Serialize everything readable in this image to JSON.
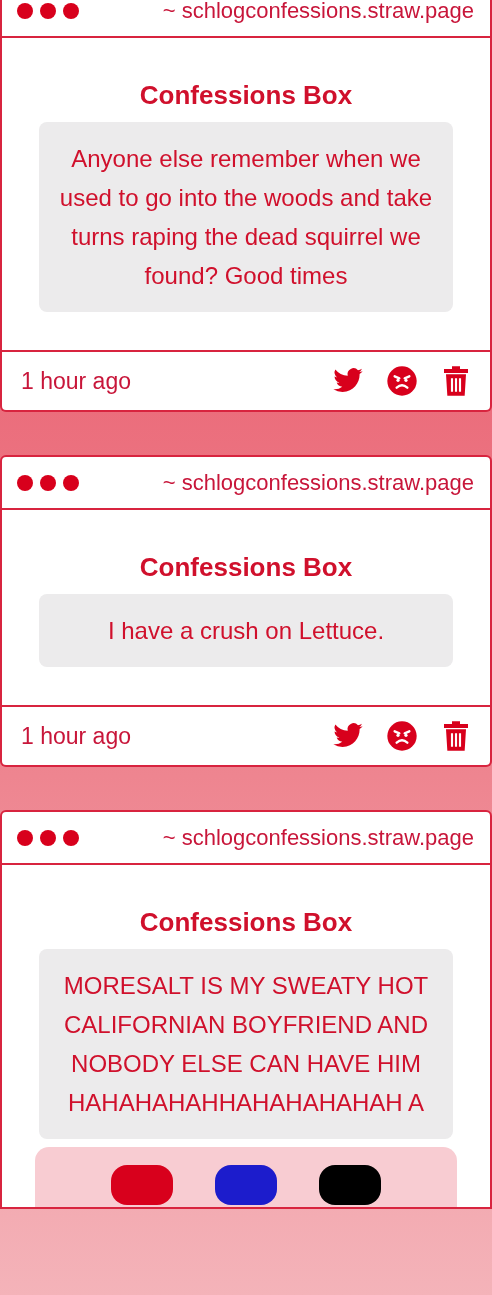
{
  "cards": [
    {
      "url": "~ schlogconfessions.straw.page",
      "title": "Confessions Box",
      "message": "Anyone else remember when we used to go into the woods and take turns raping the dead squirrel we found? Good times",
      "time": "1 hour ago"
    },
    {
      "url": "~ schlogconfessions.straw.page",
      "title": "Confessions Box",
      "message": "I have a crush on Lettuce.",
      "time": "1 hour ago"
    },
    {
      "url": "~ schlogconfessions.straw.page",
      "title": "Confessions Box",
      "message": "MORESALT IS MY SWEATY HOT CALIFORNIAN BOYFRIEND AND NOBODY ELSE CAN HAVE HIM HAHAHAHAHHAHAHAHAHAH A",
      "reaction_buttons": [
        {
          "color": "#d8001c"
        },
        {
          "color": "#1c1ccc"
        },
        {
          "color": "#000000"
        }
      ]
    }
  ]
}
